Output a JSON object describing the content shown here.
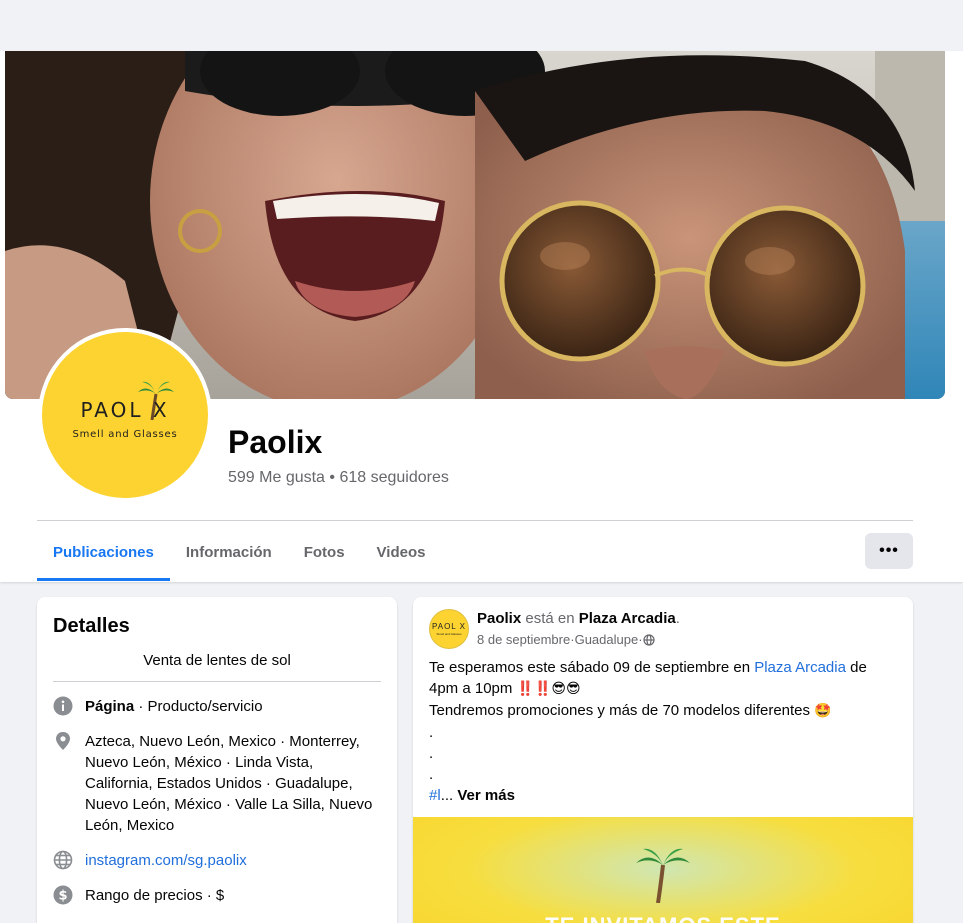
{
  "page": {
    "name": "Paolix",
    "likes": "599 Me gusta",
    "separator": " • ",
    "followers": "618 seguidores"
  },
  "logo": {
    "word": "PAOL X",
    "tagline": "Smell and Glasses"
  },
  "tabs": [
    {
      "label": "Publicaciones",
      "active": true
    },
    {
      "label": "Información",
      "active": false
    },
    {
      "label": "Fotos",
      "active": false
    },
    {
      "label": "Videos",
      "active": false
    }
  ],
  "more_button": "•••",
  "details": {
    "title": "Detalles",
    "bio": "Venta de lentes de sol",
    "category_label": "Página",
    "category_value": " · Producto/servicio",
    "locations": "Azteca, Nuevo León, Mexico · Monterrey, Nuevo León, México · Linda Vista, California, Estados Unidos · Guadalupe, Nuevo León, México · Valle La Silla, Nuevo León, Mexico",
    "website": "instagram.com/sg.paolix",
    "price_range": "Rango de precios · $"
  },
  "post": {
    "author": "Paolix",
    "verb": " está en ",
    "place": "Plaza Arcadia",
    "period": ".",
    "date": "8 de septiembre",
    "dot": " · ",
    "location": "Guadalupe",
    "line1_pre": "Te esperamos este sábado 09 de septiembre en ",
    "line1_link": "Plaza Arcadia",
    "line1_post": " de",
    "line2": "4pm a 10pm ",
    "line2_emoji": "‼️‼️😎😎",
    "line3": "Tendremos promociones y más de 70 modelos diferentes ",
    "line3_emoji": "🤩",
    "dots": [
      ".",
      ".",
      "."
    ],
    "hashtag": "#l",
    "ellipsis": "... ",
    "see_more": "Ver más",
    "image_banner": "TE INVITAMOS ESTE"
  },
  "colors": {
    "accent": "#1877f2",
    "link": "#216fdb",
    "brand_yellow": "#fcd331",
    "background": "#f0f2f5"
  }
}
